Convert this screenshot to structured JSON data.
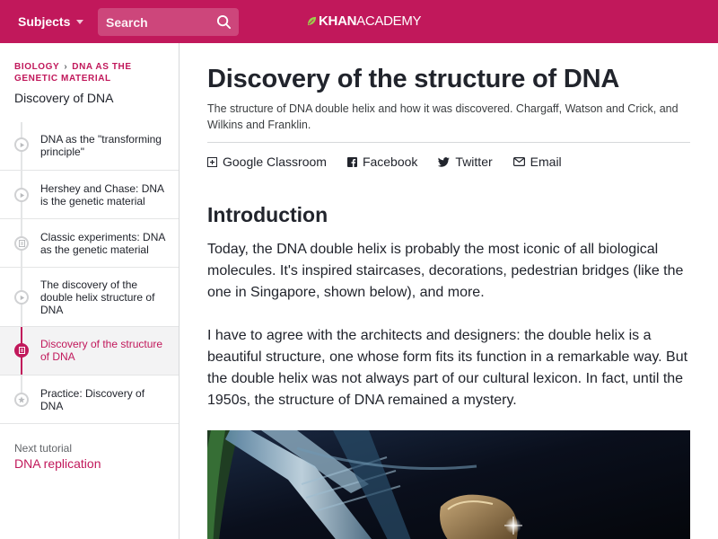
{
  "header": {
    "subjects_label": "Subjects",
    "search_placeholder": "Search",
    "logo_khan": "KHAN",
    "logo_academy": "ACADEMY",
    "brand_color": "#c1185b"
  },
  "sidebar": {
    "breadcrumb": [
      "BIOLOGY",
      "DNA AS THE GENETIC MATERIAL"
    ],
    "tutorial_title": "Discovery of DNA",
    "items": [
      {
        "label": "DNA as the \"transforming principle\"",
        "type": "video"
      },
      {
        "label": "Hershey and Chase: DNA is the genetic material",
        "type": "video"
      },
      {
        "label": "Classic experiments: DNA as the genetic material",
        "type": "article"
      },
      {
        "label": "The discovery of the double helix structure of DNA",
        "type": "video"
      },
      {
        "label": "Discovery of the structure of DNA",
        "type": "article",
        "active": true
      },
      {
        "label": "Practice: Discovery of DNA",
        "type": "exercise"
      }
    ],
    "next_label": "Next tutorial",
    "next_link": "DNA replication"
  },
  "main": {
    "title": "Discovery of the structure of DNA",
    "subtitle": "The structure of DNA double helix and how it was discovered. Chargaff, Watson and Crick, and Wilkins and Franklin.",
    "share": [
      {
        "label": "Google Classroom",
        "icon": "google-classroom-icon"
      },
      {
        "label": "Facebook",
        "icon": "facebook-icon"
      },
      {
        "label": "Twitter",
        "icon": "twitter-icon"
      },
      {
        "label": "Email",
        "icon": "email-icon"
      }
    ],
    "section_heading": "Introduction",
    "paragraph1": "Today, the DNA double helix is probably the most iconic of all biological molecules. It's inspired staircases, decorations, pedestrian bridges (like the one in Singapore, shown below), and more.",
    "paragraph2": "I have to agree with the architects and designers: the double helix is a beautiful structure, one whose form fits its function in a remarkable way. But the double helix was not always part of our cultural lexicon. In fact, until the 1950s, the structure of DNA remained a mystery."
  }
}
